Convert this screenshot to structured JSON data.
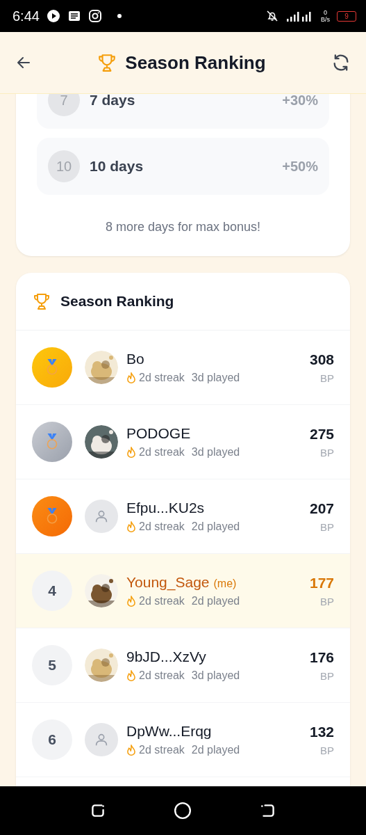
{
  "status_bar": {
    "time": "6:44",
    "net_speed": "0",
    "net_unit": "B/s",
    "battery": "9"
  },
  "header": {
    "title": "Season Ranking"
  },
  "bonus": {
    "tiers": [
      {
        "badge": "7",
        "label": "7 days",
        "bonus": "+30%"
      },
      {
        "badge": "10",
        "label": "10 days",
        "bonus": "+50%"
      }
    ],
    "note": "8 more days for max bonus!"
  },
  "ranking": {
    "title": "Season Ranking",
    "rows": [
      {
        "kind": "gold",
        "name": "Bo",
        "streak": "2d streak",
        "played": "3d played",
        "points": "308",
        "unit": "BP",
        "selected": false
      },
      {
        "kind": "silver",
        "name": "PODOGE",
        "streak": "2d streak",
        "played": "3d played",
        "points": "275",
        "unit": "BP",
        "selected": false
      },
      {
        "kind": "bronze",
        "avatar": {
          "kind": "default"
        },
        "name": "Efpu...KU2s",
        "streak": "2d streak",
        "played": "2d played",
        "points": "207",
        "unit": "BP",
        "selected": false
      },
      {
        "kind": "number",
        "rank": "4",
        "name": "Young_Sage",
        "me_tag": "(me)",
        "streak": "2d streak",
        "played": "2d played",
        "points": "177",
        "unit": "BP",
        "selected": true
      },
      {
        "kind": "number",
        "rank": "5",
        "name": "9bJD...XzVy",
        "streak": "2d streak",
        "played": "3d played",
        "points": "176",
        "unit": "BP",
        "selected": false
      },
      {
        "kind": "number",
        "rank": "6",
        "avatar": {
          "kind": "default"
        },
        "name": "DpWw...Erqg",
        "streak": "2d streak",
        "played": "2d played",
        "points": "132",
        "unit": "BP",
        "selected": false
      }
    ]
  }
}
